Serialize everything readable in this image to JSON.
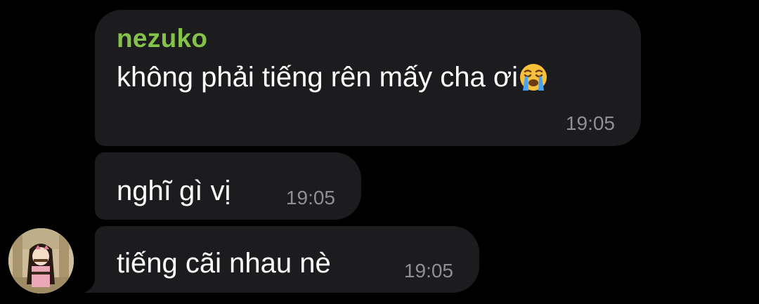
{
  "chat": {
    "messages": [
      {
        "sender": "nezuko",
        "text": "không phải tiếng rên mấy cha ơi",
        "emoji": "loudly-crying-face-icon",
        "time": "19:05"
      },
      {
        "text": "nghĩ gì vị",
        "time": "19:05"
      },
      {
        "text": "tiếng cãi nhau nè",
        "time": "19:05"
      }
    ]
  },
  "colors": {
    "background": "#000000",
    "bubble": "#1c1c1e",
    "sender_name": "#85c24a",
    "message_text": "#ffffff",
    "timestamp": "#8e8e93"
  }
}
